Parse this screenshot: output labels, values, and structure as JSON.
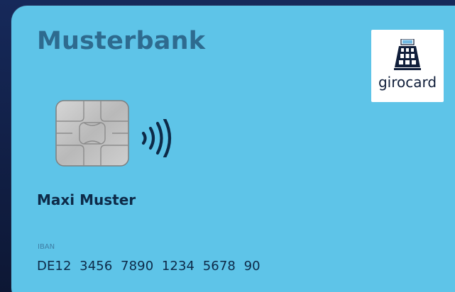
{
  "card": {
    "bank_name": "Musterbank",
    "brand": "girocard",
    "holder_name": "Maxi Muster",
    "iban_label": "IBAN",
    "iban": "DE12  3456  7890  1234  5678  90"
  },
  "colors": {
    "card_background": "#5ec4e8",
    "bank_name": "#2e6b8f",
    "text_dark": "#0d2a48",
    "outer_background": "#101c3f"
  },
  "icons": {
    "chip": "emv-chip-icon",
    "contactless": "contactless-icon",
    "brand_logo": "girocard-logo"
  }
}
